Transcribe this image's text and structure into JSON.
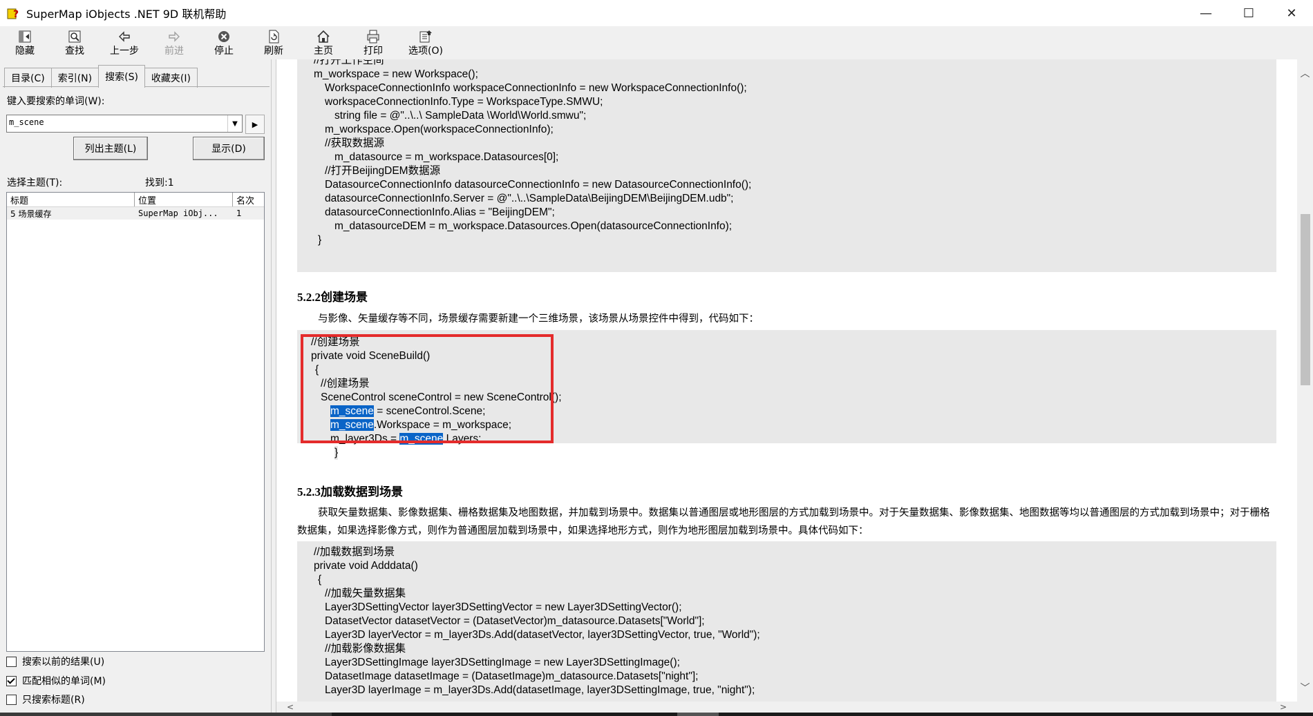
{
  "window": {
    "title": "SuperMap iObjects .NET 9D 联机帮助"
  },
  "window_controls": {
    "minimize": "—",
    "maximize": "☐",
    "close": "✕"
  },
  "toolbar": {
    "hide": "隐藏",
    "find": "查找",
    "back": "上一步",
    "forward": "前进",
    "stop": "停止",
    "refresh": "刷新",
    "home": "主页",
    "print": "打印",
    "options": "选项(O)"
  },
  "tabs": {
    "contents": "目录(C)",
    "index": "索引(N)",
    "search": "搜索(S)",
    "favorites": "收藏夹(I)"
  },
  "search": {
    "label": "键入要搜索的单词(W):",
    "value": "m_scene",
    "list_topics_button": "列出主题(L)",
    "display_button": "显示(D)",
    "select_topic_label": "选择主题(T):",
    "found_label": "找到:1"
  },
  "results": {
    "columns": [
      "标题",
      "位置",
      "名次"
    ],
    "rows": [
      {
        "title": "5 场景缓存",
        "location": "SuperMap iObj...",
        "rank": "1"
      }
    ]
  },
  "options": {
    "search_previous": {
      "label": "搜索以前的结果(U)",
      "checked": false
    },
    "match_similar": {
      "label": "匹配相似的单词(M)",
      "checked": true
    },
    "titles_only": {
      "label": "只搜索标题(R)",
      "checked": false
    }
  },
  "document": {
    "code1": [
      "//打开工作空间",
      "m_workspace = new Workspace();",
      "WorkspaceConnectionInfo workspaceConnectionInfo = new WorkspaceConnectionInfo();",
      "workspaceConnectionInfo.Type = WorkspaceType.SMWU;",
      "string file = @\"..\\..\\ SampleData \\World\\World.smwu\";",
      "m_workspace.Open(workspaceConnectionInfo);",
      "//获取数据源",
      "m_datasource = m_workspace.Datasources[0];",
      "//打开BeijingDEM数据源",
      "DatasourceConnectionInfo datasourceConnectionInfo = new DatasourceConnectionInfo();",
      "datasourceConnectionInfo.Server = @\"..\\..\\SampleData\\BeijingDEM\\BeijingDEM.udb\";",
      "datasourceConnectionInfo.Alias = \"BeijingDEM\";",
      "m_datasourceDEM = m_workspace.Datasources.Open(datasourceConnectionInfo);",
      "}"
    ],
    "heading_522": "5.2.2创建场景",
    "para_522": "与影像、矢量缓存等不同，场景缓存需要新建一个三维场景，该场景从场景控件中得到，代码如下：",
    "code2": {
      "l1": "//创建场景",
      "l2": "private void SceneBuild()",
      "l3": "{",
      "l4": "//创建场景",
      "l5": "SceneControl sceneControl = new SceneControl();",
      "hl": "m_scene",
      "l6_rest": " = sceneControl.Scene;",
      "l7_rest": ".Workspace = m_workspace;",
      "l8_pre": "m_layer3Ds = ",
      "l8_rest": ".Layers;",
      "l9": "}"
    },
    "heading_523": "5.2.3加载数据到场景",
    "para_523": "获取矢量数据集、影像数据集、栅格数据集及地图数据，并加载到场景中。数据集以普通图层或地形图层的方式加载到场景中。对于矢量数据集、影像数据集、地图数据等均以普通图层的方式加载到场景中；对于栅格数据集，如果选择影像方式，则作为普通图层加载到场景中，如果选择地形方式，则作为地形图层加载到场景中。具体代码如下：",
    "code3": [
      "//加载数据到场景",
      "private void Adddata()",
      "{",
      "//加载矢量数据集",
      "Layer3DSettingVector layer3DSettingVector = new Layer3DSettingVector();",
      "DatasetVector datasetVector = (DatasetVector)m_datasource.Datasets[\"World\"];",
      "Layer3D layerVector = m_layer3Ds.Add(datasetVector, layer3DSettingVector, true, \"World\");",
      "//加载影像数据集",
      "Layer3DSettingImage layer3DSettingImage = new Layer3DSettingImage();",
      "DatasetImage datasetImage = (DatasetImage)m_datasource.Datasets[\"night\"];",
      "Layer3D layerImage = m_layer3Ds.Add(datasetImage, layer3DSettingImage, true, \"night\");"
    ]
  },
  "colors": {
    "highlight": "#0a64c7",
    "annotation_box": "#e42b2b",
    "code_bg": "#e8e8e8"
  }
}
